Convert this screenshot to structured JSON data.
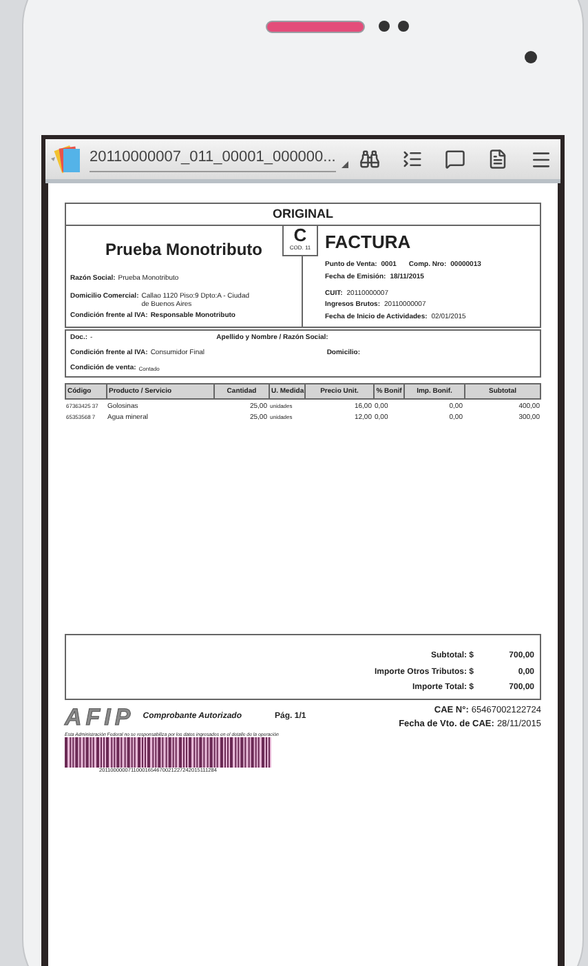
{
  "toolbar": {
    "file_name": "20110000007_011_00001_000000..."
  },
  "invoice": {
    "header": "ORIGINAL",
    "company": "Prueba Monotributo",
    "letter": "C",
    "code": "COD. 11",
    "doc_type": "FACTURA",
    "issuer_fields": [
      {
        "label": "Razón Social:",
        "value": "Prueba Monotributo"
      },
      {
        "label": "Domicilio Comercial:",
        "value": "Callao 1120 Piso:9 Dpto:A - Ciudad de Buenos Aires"
      },
      {
        "label": "Condición frente al IVA:",
        "value": "Responsable Monotributo"
      }
    ],
    "punto_label": "Punto de Venta:",
    "punto_value": "0001",
    "comp_label": "Comp. Nro:",
    "comp_value": "00000013",
    "invoice_fields": [
      {
        "label": "Fecha de Emisión:",
        "value": "18/11/2015"
      },
      {
        "label": "CUIT:",
        "value": "20110000007"
      },
      {
        "label": "Ingresos Brutos:",
        "value": "20110000007"
      },
      {
        "label": "Fecha de Inicio de Actividades:",
        "value": "02/01/2015"
      }
    ],
    "client": {
      "doc_label": "Doc.:",
      "doc_value": "-",
      "name_label": "Apellido y Nombre / Razón Social:",
      "iva_label": "Condición frente al IVA:",
      "iva_value": "Consumidor Final",
      "address_label": "Domicilio:",
      "sale_label": "Condición de venta:",
      "sale_value": "Contado"
    },
    "columns": [
      "Código",
      "Producto / Servicio",
      "Cantidad",
      "U. Medida",
      "Precio Unit.",
      "% Bonif",
      "Imp. Bonif.",
      "Subtotal"
    ],
    "rows": [
      [
        "67363425 37",
        "Golosinas",
        "25,00",
        "unidades",
        "16,00",
        "0,00",
        "0,00",
        "400,00"
      ],
      [
        "65353568 7",
        "Agua mineral",
        "25,00",
        "unidades",
        "12,00",
        "0,00",
        "0,00",
        "300,00"
      ]
    ],
    "totals": [
      {
        "label": "Subtotal: $",
        "value": "700,00"
      },
      {
        "label": "Importe Otros Tributos: $",
        "value": "0,00"
      },
      {
        "label": "Importe Total: $",
        "value": "700,00"
      }
    ],
    "logo": "AFIP",
    "authorized": "Comprobante Autorizado",
    "page": "Pág. 1/1",
    "cae_label": "CAE N°:",
    "cae_value": "65467002122724",
    "cae_due_label": "Fecha de Vto. de CAE:",
    "cae_due_value": "28/11/2015",
    "disclaimer": "Esta Administración Federal no se responsabiliza por los datos ingresados en el detalle de la operación",
    "barcode_number": "20110000007110001654670021227242015111284"
  }
}
